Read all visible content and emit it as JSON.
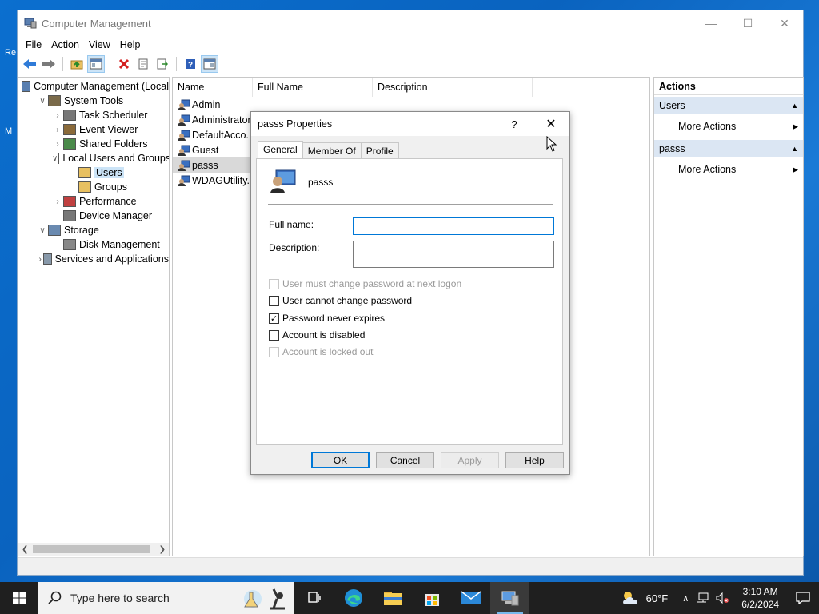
{
  "desktop": {
    "icon_text_1": "Re",
    "icon_text_2": "M"
  },
  "window": {
    "title": "Computer Management",
    "menu": [
      "File",
      "Action",
      "View",
      "Help"
    ]
  },
  "tree": {
    "items": [
      {
        "label": "Computer Management (Local",
        "indent": 0,
        "chev": ""
      },
      {
        "label": "System Tools",
        "indent": 1,
        "chev": "v"
      },
      {
        "label": "Task Scheduler",
        "indent": 2,
        "chev": ">"
      },
      {
        "label": "Event Viewer",
        "indent": 2,
        "chev": ">"
      },
      {
        "label": "Shared Folders",
        "indent": 2,
        "chev": ">"
      },
      {
        "label": "Local Users and Groups",
        "indent": 2,
        "chev": "v"
      },
      {
        "label": "Users",
        "indent": 3,
        "chev": ""
      },
      {
        "label": "Groups",
        "indent": 3,
        "chev": ""
      },
      {
        "label": "Performance",
        "indent": 2,
        "chev": ">"
      },
      {
        "label": "Device Manager",
        "indent": 2,
        "chev": ""
      },
      {
        "label": "Storage",
        "indent": 1,
        "chev": "v"
      },
      {
        "label": "Disk Management",
        "indent": 2,
        "chev": ""
      },
      {
        "label": "Services and Applications",
        "indent": 1,
        "chev": ">"
      }
    ]
  },
  "list": {
    "columns": [
      "Name",
      "Full Name",
      "Description"
    ],
    "rows": [
      "Admin",
      "Administrator",
      "DefaultAcco...",
      "Guest",
      "passs",
      "WDAGUtility..."
    ]
  },
  "actions": {
    "title": "Actions",
    "section1": "Users",
    "section1_item": "More Actions",
    "section2": "passs",
    "section2_item": "More Actions"
  },
  "dialog": {
    "title": "passs Properties",
    "help": "?",
    "tabs": [
      "General",
      "Member Of",
      "Profile"
    ],
    "username": "passs",
    "full_name_label": "Full name:",
    "full_name_value": "",
    "description_label": "Description:",
    "description_value": "",
    "checkboxes": [
      {
        "label": "User must change password at next logon",
        "checked": false,
        "disabled": true
      },
      {
        "label": "User cannot change password",
        "checked": false,
        "disabled": false
      },
      {
        "label": "Password never expires",
        "checked": true,
        "disabled": false
      },
      {
        "label": "Account is disabled",
        "checked": false,
        "disabled": false
      },
      {
        "label": "Account is locked out",
        "checked": false,
        "disabled": true
      }
    ],
    "buttons": {
      "ok": "OK",
      "cancel": "Cancel",
      "apply": "Apply",
      "help": "Help"
    }
  },
  "taskbar": {
    "search_placeholder": "Type here to search",
    "weather": "60°F",
    "time": "3:10 AM",
    "date": "6/2/2024"
  }
}
